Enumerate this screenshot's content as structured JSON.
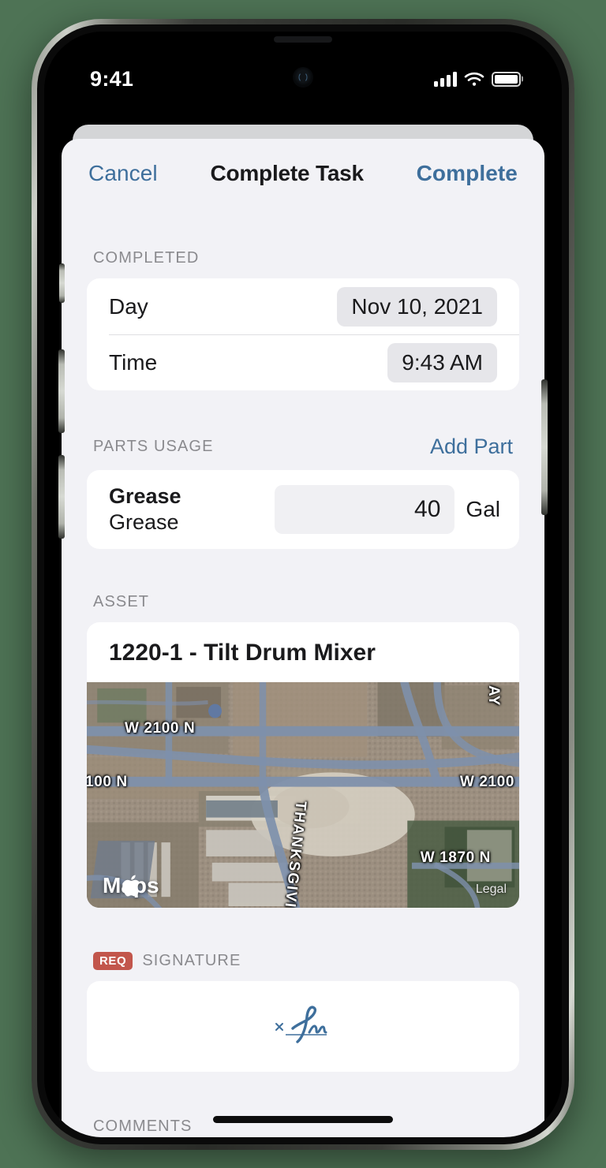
{
  "statusbar": {
    "time": "9:41",
    "signal_icon": "cellular-signal-icon",
    "wifi_icon": "wifi-icon",
    "battery_icon": "battery-icon"
  },
  "navbar": {
    "cancel_label": "Cancel",
    "title": "Complete Task",
    "complete_label": "Complete"
  },
  "sections": {
    "completed": {
      "header": "COMPLETED",
      "rows": [
        {
          "label": "Day",
          "value": "Nov 10, 2021"
        },
        {
          "label": "Time",
          "value": "9:43 AM"
        }
      ]
    },
    "parts_usage": {
      "header": "PARTS USAGE",
      "action_label": "Add Part",
      "part": {
        "title": "Grease",
        "subtitle": "Grease",
        "quantity": "40",
        "unit": "Gal"
      }
    },
    "asset": {
      "header": "ASSET",
      "title": "1220-1 - Tilt Drum Mixer",
      "map": {
        "pin_icon": "map-pin-icon",
        "attribution": "Maps",
        "legal_label": "Legal",
        "labels": [
          "W 2100 N",
          "100 N",
          "W 2100",
          "THANKSGIVING WAY",
          "W 1870 N",
          "AY"
        ]
      }
    },
    "signature": {
      "badge": "REQ",
      "header": "SIGNATURE",
      "placeholder_icon": "signature-line-icon"
    },
    "comments": {
      "header": "COMMENTS"
    }
  },
  "colors": {
    "accent_blue": "#3e6f9c",
    "badge_red": "#c2564c",
    "pin_red": "#fb0007",
    "sheet_bg": "#f2f2f6",
    "card_bg": "#ffffff",
    "backdrop_green": "#4e7355"
  }
}
